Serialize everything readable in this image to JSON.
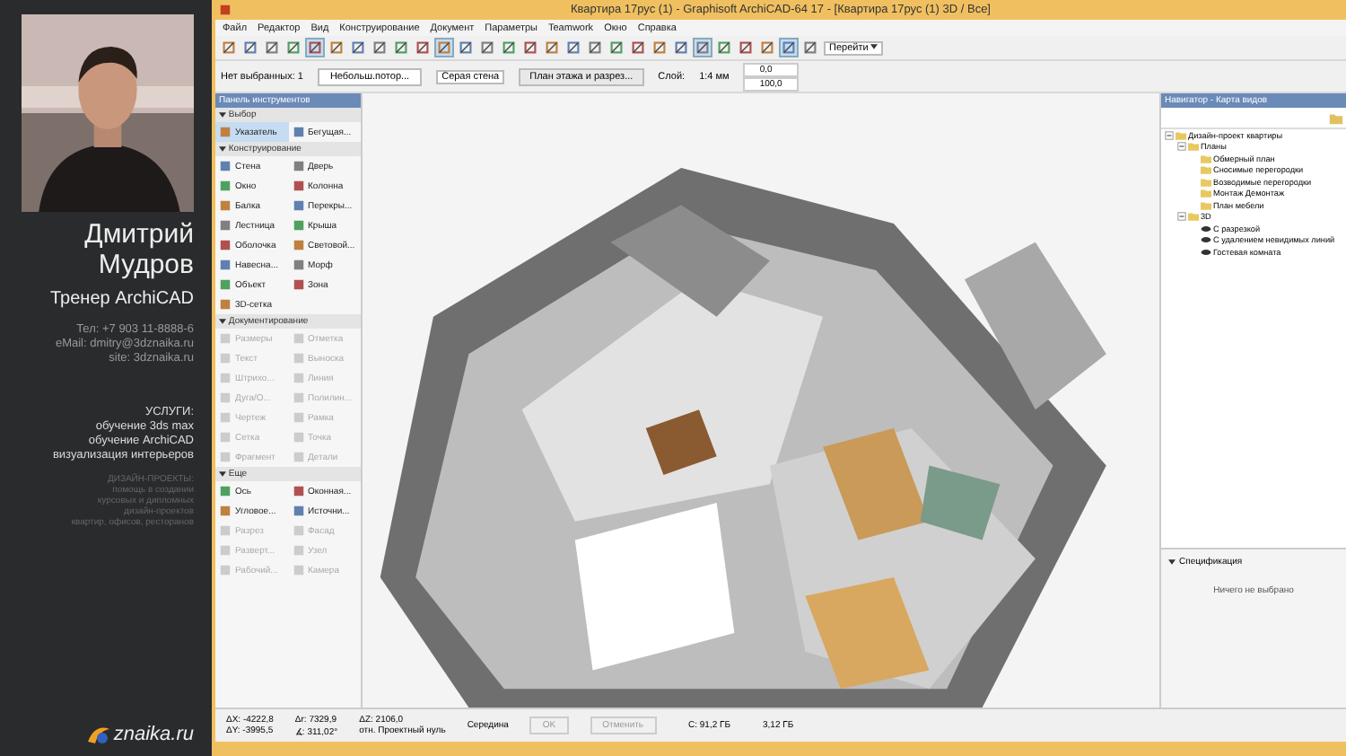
{
  "presenter": {
    "name_lines": [
      "Дмитрий",
      "Мудров"
    ],
    "role": "Тренер ArchiCAD",
    "contacts": [
      "Тел: +7 903 11-8888-6",
      "eMail: dmitry@3dznaika.ru",
      "site: 3dznaika.ru"
    ],
    "services_title": "УСЛУГИ:",
    "services": [
      "обучение 3ds max",
      "обучение ArchiCAD",
      "визуализация интерьеров"
    ],
    "projects_title": "ДИЗАЙН-ПРОЕКТЫ:",
    "projects": [
      "помощь в создании",
      "курсовых и дипломных",
      "дизайн-проектов",
      "квартир, офисов, ресторанов"
    ],
    "logo": "znaika.ru"
  },
  "window": {
    "title": "Квартира 17рус (1) - Graphisoft ArchiCAD-64 17 - [Квартира 17рус (1) 3D / Все]",
    "menu": [
      "Файл",
      "Редактор",
      "Вид",
      "Конструирование",
      "Документ",
      "Параметры",
      "Teamwork",
      "Окно",
      "Справка"
    ]
  },
  "toolbar": [
    {
      "selected": false
    },
    {
      "selected": false
    },
    {
      "selected": false
    },
    {
      "selected": false
    },
    {
      "selected": true
    },
    {
      "selected": false
    },
    {
      "selected": false
    },
    {
      "selected": false
    },
    {
      "selected": false
    },
    {
      "selected": false
    },
    {
      "selected": true
    },
    {
      "selected": false
    },
    {
      "selected": false
    },
    {
      "selected": false
    },
    {
      "selected": false
    },
    {
      "selected": false
    },
    {
      "selected": false
    },
    {
      "selected": false
    },
    {
      "selected": false
    },
    {
      "selected": false
    },
    {
      "selected": false
    },
    {
      "selected": false
    },
    {
      "selected": true
    },
    {
      "selected": false
    },
    {
      "selected": false
    },
    {
      "selected": false
    },
    {
      "selected": true
    },
    {
      "selected": false
    }
  ],
  "toolbar_dropdown": "Перейти",
  "info_box": {
    "selection": "Нет выбранных: 1",
    "layer_dropdown": "Небольш.потор...",
    "surface_dropdown": "Серая стена",
    "view_button": "План этажа и разрез...",
    "scale_label": "Слой:",
    "scale": "1:4 мм",
    "values": [
      "0,0",
      "100,0"
    ]
  },
  "toolbox": {
    "title": "Панель инструментов",
    "sections": [
      {
        "title": "Выбор",
        "expanded": true,
        "items": [
          {
            "label": "Указатель",
            "selected": true,
            "disabled": false
          },
          {
            "label": "Бегущая...",
            "selected": false,
            "disabled": false
          }
        ]
      },
      {
        "title": "Конструирование",
        "expanded": true,
        "items": [
          {
            "label": "Стена",
            "selected": false,
            "disabled": false
          },
          {
            "label": "Дверь",
            "selected": false,
            "disabled": false
          },
          {
            "label": "Окно",
            "selected": false,
            "disabled": false
          },
          {
            "label": "Колонна",
            "selected": false,
            "disabled": false
          },
          {
            "label": "Балка",
            "selected": false,
            "disabled": false
          },
          {
            "label": "Перекры...",
            "selected": false,
            "disabled": false
          },
          {
            "label": "Лестница",
            "selected": false,
            "disabled": false
          },
          {
            "label": "Крыша",
            "selected": false,
            "disabled": false
          },
          {
            "label": "Оболочка",
            "selected": false,
            "disabled": false
          },
          {
            "label": "Световой...",
            "selected": false,
            "disabled": false
          },
          {
            "label": "Навесна...",
            "selected": false,
            "disabled": false
          },
          {
            "label": "Морф",
            "selected": false,
            "disabled": false
          },
          {
            "label": "Объект",
            "selected": false,
            "disabled": false
          },
          {
            "label": "Зона",
            "selected": false,
            "disabled": false
          },
          {
            "label": "3D-сетка",
            "selected": false,
            "disabled": false
          }
        ]
      },
      {
        "title": "Документирование",
        "expanded": true,
        "items": [
          {
            "label": "Размеры",
            "selected": false,
            "disabled": true
          },
          {
            "label": "Отметка",
            "selected": false,
            "disabled": true
          },
          {
            "label": "Текст",
            "selected": false,
            "disabled": true
          },
          {
            "label": "Выноска",
            "selected": false,
            "disabled": true
          },
          {
            "label": "Штрихо...",
            "selected": false,
            "disabled": true
          },
          {
            "label": "Линия",
            "selected": false,
            "disabled": true
          },
          {
            "label": "Дуга/О...",
            "selected": false,
            "disabled": true
          },
          {
            "label": "Полилин...",
            "selected": false,
            "disabled": true
          },
          {
            "label": "Чертеж",
            "selected": false,
            "disabled": true
          },
          {
            "label": "Рамка",
            "selected": false,
            "disabled": true
          },
          {
            "label": "Сетка",
            "selected": false,
            "disabled": true
          },
          {
            "label": "Точка",
            "selected": false,
            "disabled": true
          },
          {
            "label": "Фрагмент",
            "selected": false,
            "disabled": true
          },
          {
            "label": "Детали",
            "selected": false,
            "disabled": true
          }
        ]
      },
      {
        "title": "Еще",
        "expanded": true,
        "items": [
          {
            "label": "Ось",
            "selected": false,
            "disabled": false
          },
          {
            "label": "Оконная...",
            "selected": false,
            "disabled": false
          },
          {
            "label": "Угловое...",
            "selected": false,
            "disabled": false
          },
          {
            "label": "Источни...",
            "selected": false,
            "disabled": false
          },
          {
            "label": "Разрез",
            "selected": false,
            "disabled": true
          },
          {
            "label": "Фасад",
            "selected": false,
            "disabled": true
          },
          {
            "label": "Разверт...",
            "selected": false,
            "disabled": true
          },
          {
            "label": "Узел",
            "selected": false,
            "disabled": true
          },
          {
            "label": "Рабочий...",
            "selected": false,
            "disabled": true
          },
          {
            "label": "Камера",
            "selected": false,
            "disabled": true
          }
        ]
      }
    ]
  },
  "navigator": {
    "title": "Навигатор - Карта видов",
    "tree": [
      {
        "label": "Дизайн-проект квартиры",
        "kind": "folder",
        "expanded": true,
        "children": [
          {
            "label": "Планы",
            "kind": "folder",
            "expanded": true,
            "children": [
              {
                "label": "Обмерный план",
                "kind": "folder"
              },
              {
                "label": "Сносимые перегородки",
                "kind": "folder"
              },
              {
                "label": "Возводимые перегородки",
                "kind": "folder"
              },
              {
                "label": "Монтаж Демонтаж",
                "kind": "folder"
              },
              {
                "label": "План мебели",
                "kind": "folder"
              }
            ]
          },
          {
            "label": "3D",
            "kind": "folder",
            "expanded": true,
            "children": [
              {
                "label": "С разрезкой",
                "kind": "view"
              },
              {
                "label": "С удалением невидимых линий",
                "kind": "view"
              },
              {
                "label": "Гостевая комната",
                "kind": "view"
              }
            ]
          }
        ]
      }
    ],
    "spec_title": "Спецификация",
    "spec_text": "Ничего не выбрано"
  },
  "coords": {
    "dx": "ΔX: -4222,8",
    "dy": "ΔY: -3995,5",
    "dr": "Δr: 7329,9",
    "angle": "∡: 311,02°",
    "dz": "ΔZ: 2106,0",
    "ref": "отн. Проектный нуль",
    "snap": "Середина",
    "ok": "OK",
    "cancel": "Отменить"
  },
  "status": {
    "disk": "C: 91,2 ГБ",
    "memory": "3,12 ГБ"
  }
}
